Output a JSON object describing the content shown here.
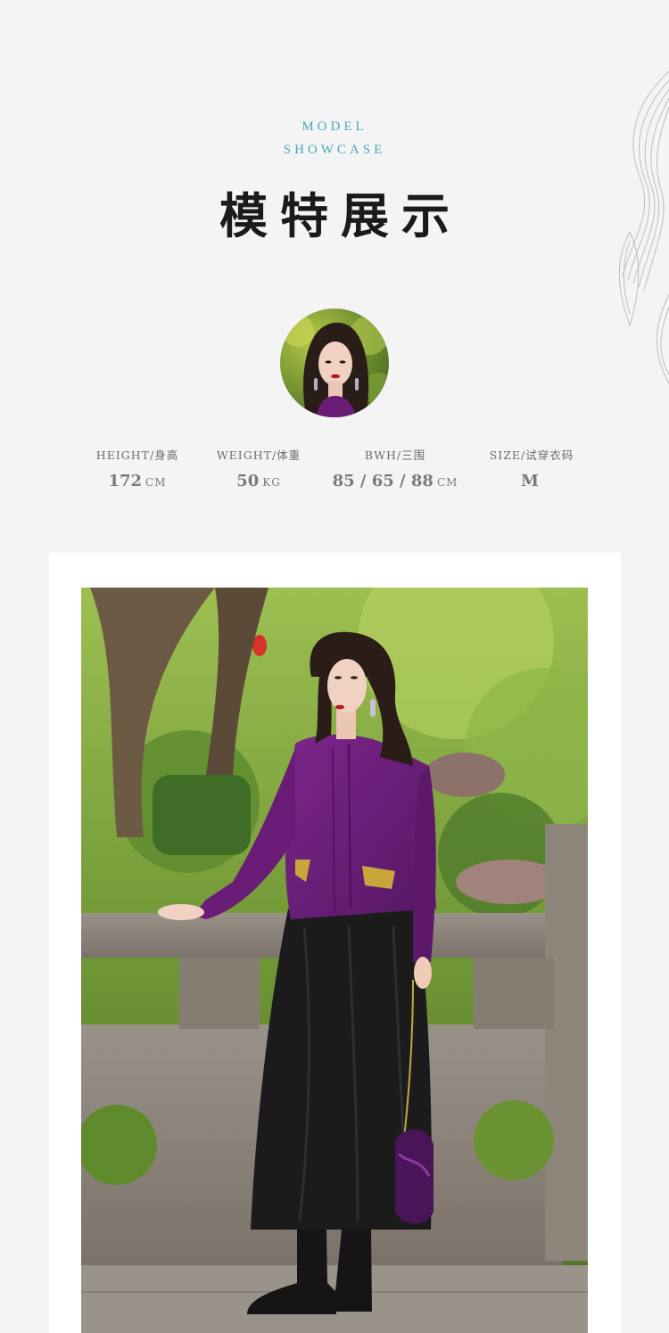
{
  "header": {
    "eyebrow_line1": "MODEL",
    "eyebrow_line2": "SHOWCASE",
    "title": "模特展示"
  },
  "stats": [
    {
      "label": "HEIGHT/身高",
      "value": "172",
      "unit": "CM"
    },
    {
      "label": "WEIGHT/体重",
      "value": "50",
      "unit": "KG"
    },
    {
      "label": "BWH/三围",
      "value": "85 / 65 / 88",
      "unit": "CM"
    },
    {
      "label": "SIZE/试穿衣码",
      "value": "M",
      "unit": ""
    }
  ],
  "colors": {
    "background": "#f4f4f4",
    "accent_teal": "#47a9b9",
    "title_black": "#1a1a1a",
    "jacket_purple": "#6a1d77",
    "skirt_black": "#1b1b1b"
  }
}
